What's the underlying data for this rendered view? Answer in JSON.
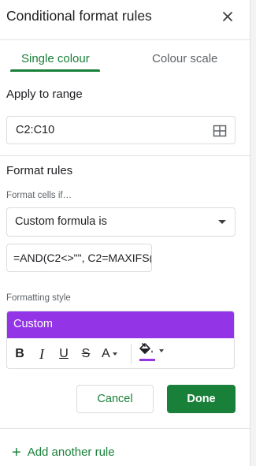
{
  "panel": {
    "title": "Conditional format rules"
  },
  "tabs": [
    {
      "label": "Single colour",
      "active": true
    },
    {
      "label": "Colour scale",
      "active": false
    }
  ],
  "apply_to_range": {
    "heading": "Apply to range",
    "value": "C2:C10"
  },
  "format_rules": {
    "heading": "Format rules",
    "condition_label": "Format cells if…",
    "condition_value": "Custom formula is",
    "formula_value": "=AND(C2<>\"\", C2=MAXIFS("
  },
  "formatting_style": {
    "heading": "Formatting style",
    "preview_label": "Custom",
    "preview_color": "#9334e6",
    "toolbar": {
      "bold": "B",
      "italic": "I",
      "underline": "U",
      "strikethrough": "S",
      "text_color": "A"
    }
  },
  "actions": {
    "cancel_label": "Cancel",
    "done_label": "Done"
  },
  "add_rule": {
    "label": "Add another rule"
  },
  "colors": {
    "accent": "#188038",
    "custom_style": "#9334e6"
  }
}
